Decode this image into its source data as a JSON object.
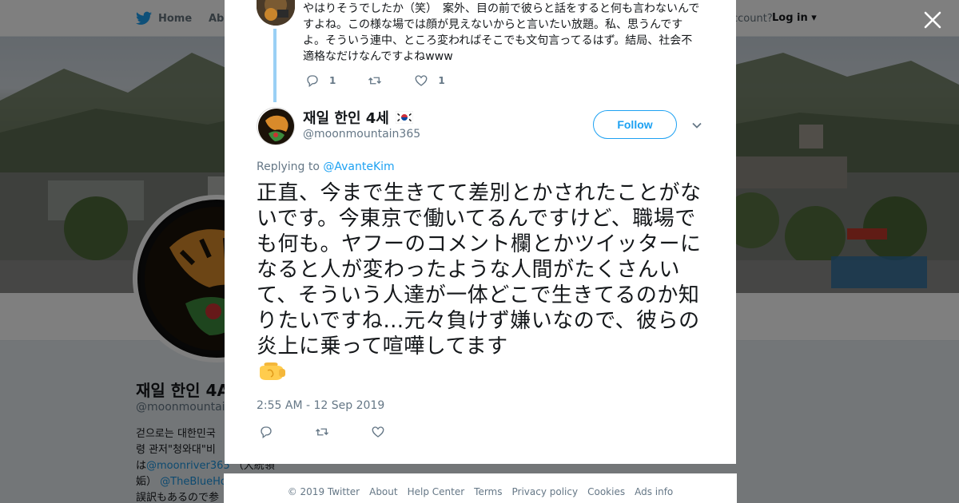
{
  "background": {
    "nav": {
      "home_label": "Home",
      "about_label": "Abo",
      "account_text": "ccount?",
      "login_label": "Log in"
    },
    "profile": {
      "name": "재일 한인 4A",
      "handle": "@moonmountain3",
      "bio_line1": "걷으로는 대한민국",
      "bio_line2": "령 관저\"청와대\"비",
      "bio_line3_prefix": "は",
      "bio_link1": "@moonriver365",
      "bio_line3_suffix": "（大統領",
      "bio_line4_prefix": "姤）",
      "bio_link2": "@TheBlueHo",
      "bio_line5": "誤訳もあるので参"
    }
  },
  "modal": {
    "parent_tweet": {
      "text": "やはりそうでしたか（笑）　案外、目の前で彼らと話をすると何も言わないんですよね。この様な場では顔が見えないからと言いたい放題。私、思うんですよ。そういう連中、ところ変わればそこでも文句言ってるはず。結局、社会不適格なだけなんですよねwww",
      "reply_count": "1",
      "like_count": "1"
    },
    "tweet": {
      "author_name": "재일 한인 4세",
      "author_handle": "@moonmountain365",
      "follow_label": "Follow",
      "replying_prefix": "Replying to",
      "replying_handle": "@AvanteKim",
      "text": "正直、今まで生きてて差別とかされたことがないです。今東京で働いてるんですけど、職場でも何も。ヤフーのコメント欄とかツイッターになると人が変わったような人間がたくさんいて、そういう人達が一体どこで生きてるのか知りたいですね…元々負けず嫌いなので、彼らの炎上に乗って喧嘩してます",
      "timestamp": "2:55 AM - 12 Sep 2019"
    }
  },
  "footer": {
    "links": [
      "© 2019 Twitter",
      "About",
      "Help Center",
      "Terms",
      "Privacy policy",
      "Cookies",
      "Ads info"
    ]
  },
  "colors": {
    "accent": "#1da1f2",
    "thread_line": "#9ad0f5",
    "muted": "#657786"
  },
  "icons": [
    "twitter-bird-icon",
    "close-icon",
    "reply-icon",
    "retweet-icon",
    "like-icon",
    "chevron-down-icon",
    "korea-flag-icon",
    "fist-emoji-icon"
  ]
}
